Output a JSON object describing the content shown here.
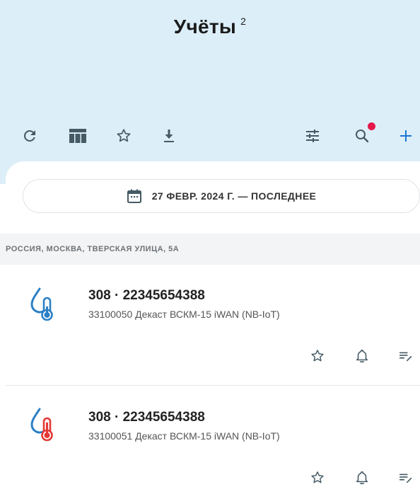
{
  "header": {
    "title": "Учёты",
    "count": "2"
  },
  "toolbar": {
    "items": [
      "refresh-icon",
      "table-icon",
      "star-icon",
      "download-icon",
      "filter-sliders-icon",
      "search-icon",
      "plus-icon"
    ],
    "search_badge_color": "#e5184a",
    "accent_color": "#1976d2"
  },
  "date_filter": {
    "label": "27 ФЕВР. 2024 Г. — ПОСЛЕДНЕЕ",
    "icon": "calendar-icon"
  },
  "address": {
    "label": "РОССИЯ, МОСКВА, ТВЕРСКАЯ УЛИЦА, 5А"
  },
  "records": [
    {
      "title": "308  ·  22345654388",
      "subtitle": "33100050 Декаст ВСКМ-15 iWAN (NB-IoT)",
      "icon": "cold-water-thermometer-icon",
      "icon_color": "#2a7fc6"
    },
    {
      "title": "308  ·  22345654388",
      "subtitle": "33100051 Декаст ВСКМ-15 iWAN (NB-IoT)",
      "icon": "hot-water-thermometer-icon",
      "icon_color": "#e53935"
    }
  ]
}
